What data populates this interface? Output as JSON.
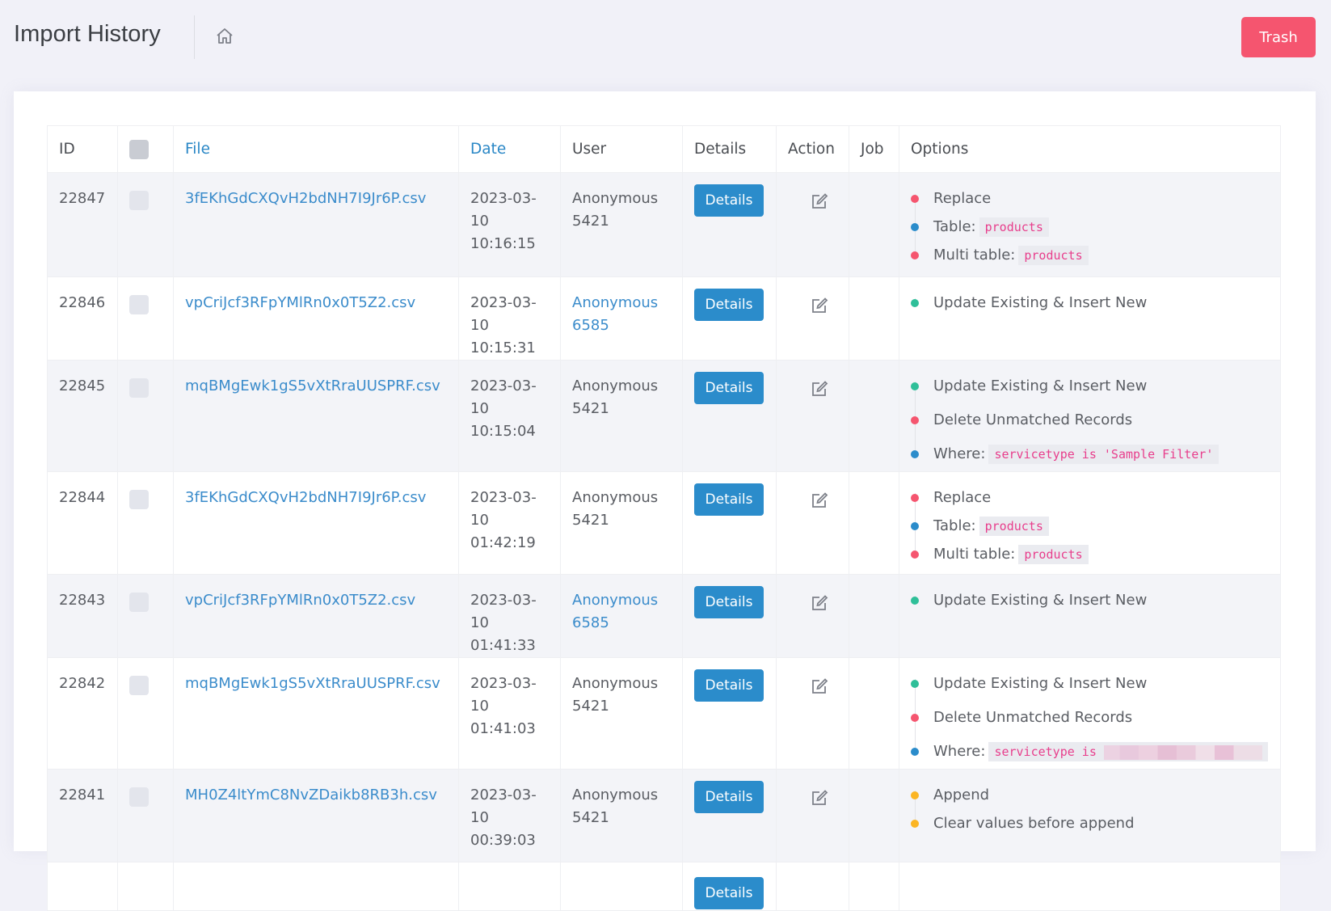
{
  "header": {
    "title": "Import History",
    "home_icon": "home-icon",
    "trash_label": "Trash"
  },
  "colors": {
    "accent": "#2b8ccb",
    "danger": "#f5556f",
    "dot_red": "#f5556f",
    "dot_blue": "#2b8ccb",
    "dot_green": "#2fbf99",
    "dot_yellow": "#fbb524"
  },
  "table": {
    "columns": [
      "ID",
      "",
      "File",
      "Date",
      "User",
      "Details",
      "Action",
      "Job",
      "Options"
    ],
    "details_label": "Details",
    "rows": [
      {
        "id": "22847",
        "file": "3fEKhGdCXQvH2bdNH7I9Jr6P.csv",
        "date_line1": "2023-03-",
        "date_line2": "10 10:16:15",
        "user_line1": "Anonymous",
        "user_line2": "5421",
        "user_link": false,
        "job": "",
        "options": [
          {
            "dot": "red",
            "text": "Replace"
          },
          {
            "dot": "blue",
            "text": "Table:",
            "code": "products"
          },
          {
            "dot": "red",
            "text": "Multi table:",
            "code": "products"
          }
        ]
      },
      {
        "id": "22846",
        "file": "vpCriJcf3RFpYMlRn0x0T5Z2.csv",
        "date_line1": "2023-03-",
        "date_line2": "10 10:15:31",
        "user_line1": "Anonymous",
        "user_line2": "6585",
        "user_link": true,
        "job": "",
        "options": [
          {
            "dot": "green",
            "text": "Update Existing & Insert New"
          }
        ]
      },
      {
        "id": "22845",
        "file": "mqBMgEwk1gS5vXtRraUUSPRF.csv",
        "date_line1": "2023-03-",
        "date_line2": "10 10:15:04",
        "user_line1": "Anonymous",
        "user_line2": "5421",
        "user_link": false,
        "job": "",
        "options": [
          {
            "dot": "green",
            "text": "Update Existing & Insert New"
          },
          {
            "dot": "red",
            "text": "Delete Unmatched Records"
          },
          {
            "dot": "blue",
            "text": "Where:",
            "code": "servicetype is 'Sample Filter'"
          }
        ]
      },
      {
        "id": "22844",
        "file": "3fEKhGdCXQvH2bdNH7I9Jr6P.csv",
        "date_line1": "2023-03-",
        "date_line2": "10 01:42:19",
        "user_line1": "Anonymous",
        "user_line2": "5421",
        "user_link": false,
        "job": "",
        "options": [
          {
            "dot": "red",
            "text": "Replace"
          },
          {
            "dot": "blue",
            "text": "Table:",
            "code": "products"
          },
          {
            "dot": "red",
            "text": "Multi table:",
            "code": "products"
          }
        ]
      },
      {
        "id": "22843",
        "file": "vpCriJcf3RFpYMlRn0x0T5Z2.csv",
        "date_line1": "2023-03-",
        "date_line2": "10 01:41:33",
        "user_line1": "Anonymous",
        "user_line2": "6585",
        "user_link": true,
        "job": "",
        "options": [
          {
            "dot": "green",
            "text": "Update Existing & Insert New"
          }
        ]
      },
      {
        "id": "22842",
        "file": "mqBMgEwk1gS5vXtRraUUSPRF.csv",
        "date_line1": "2023-03-",
        "date_line2": "10 01:41:03",
        "user_line1": "Anonymous",
        "user_line2": "5421",
        "user_link": false,
        "job": "",
        "options": [
          {
            "dot": "green",
            "text": "Update Existing & Insert New"
          },
          {
            "dot": "red",
            "text": "Delete Unmatched Records"
          },
          {
            "dot": "blue",
            "text": "Where:",
            "code": "servicetype is",
            "redacted": true
          }
        ]
      },
      {
        "id": "22841",
        "file": "MH0Z4ltYmC8NvZDaikb8RB3h.csv",
        "date_line1": "2023-03-",
        "date_line2": "10",
        "date_line3": "00:39:03",
        "user_line1": "Anonymous",
        "user_line2": "5421",
        "user_link": false,
        "job": "",
        "options": [
          {
            "dot": "yellow",
            "text": "Append"
          },
          {
            "dot": "yellow",
            "text": "Clear values before append"
          }
        ]
      }
    ]
  }
}
